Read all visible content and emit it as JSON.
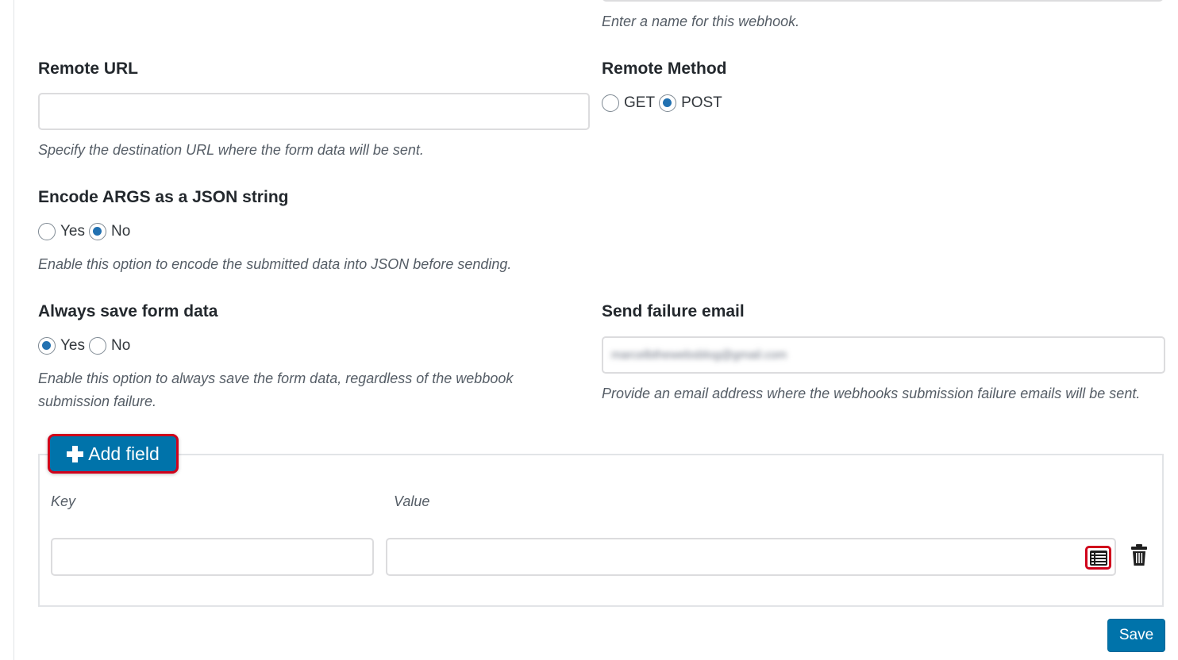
{
  "webhook_name": {
    "help": "Enter a name for this webhook."
  },
  "remote_url": {
    "label": "Remote URL",
    "value": "",
    "help": "Specify the destination URL where the form data will be sent."
  },
  "remote_method": {
    "label": "Remote Method",
    "options": [
      "GET",
      "POST"
    ],
    "selected": "POST"
  },
  "encode_args": {
    "label": "Encode ARGS as a JSON string",
    "options": [
      "Yes",
      "No"
    ],
    "selected": "No",
    "help": "Enable this option to encode the submitted data into JSON before sending."
  },
  "always_save": {
    "label": "Always save form data",
    "options": [
      "Yes",
      "No"
    ],
    "selected": "Yes",
    "help_line1": "Enable this option to always save the form data, regardless of the webbook",
    "help_line2": "submission failure."
  },
  "failure_email": {
    "label": "Send failure email",
    "value": "marcelbthewebsblog@gmail.com",
    "help": "Provide an email address where the webhooks submission failure emails will be sent."
  },
  "fields": {
    "add_button_label": "Add field",
    "key_label": "Key",
    "value_label": "Value",
    "rows": [
      {
        "key": "",
        "value": ""
      }
    ]
  },
  "actions": {
    "save_label": "Save"
  },
  "icons": {
    "add": "plus-icon",
    "merge_tags": "list-icon",
    "delete": "trash-icon"
  },
  "colors": {
    "primary": "#0073aa",
    "radio_checked": "#2271b1",
    "highlight": "#d0021b"
  }
}
